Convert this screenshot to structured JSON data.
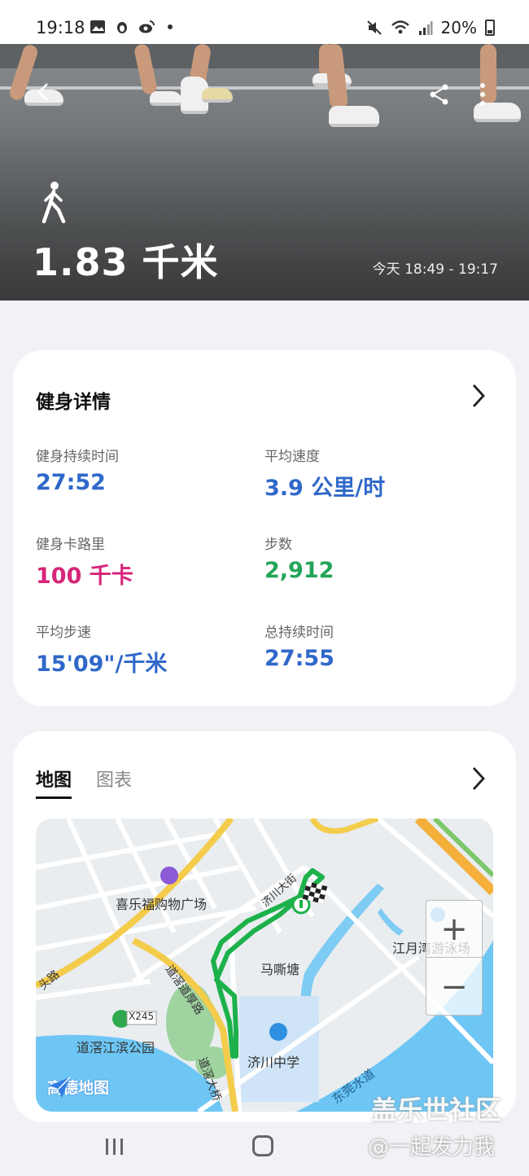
{
  "status_bar": {
    "time": "19:18",
    "battery": "20%"
  },
  "hero": {
    "distance": "1.83 千米",
    "time_range": "今天 18:49 - 19:17"
  },
  "details": {
    "title": "健身详情",
    "stats": [
      {
        "label": "健身持续时间",
        "value": "27:52",
        "color": "#2f68c9"
      },
      {
        "label": "平均速度",
        "value": "3.9 公里/时",
        "color": "#2f68c9"
      },
      {
        "label": "健身卡路里",
        "value": "100 千卡",
        "color": "#d6257a"
      },
      {
        "label": "步数",
        "value": "2,912",
        "color": "#23a559"
      },
      {
        "label": "平均步速",
        "value": "15'09\"/千米",
        "color": "#2f68c9"
      },
      {
        "label": "总持续时间",
        "value": "27:55",
        "color": "#2f68c9"
      }
    ]
  },
  "map_card": {
    "tabs": [
      "地图",
      "图表"
    ],
    "active_tab": "地图",
    "map_labels": {
      "mall": "喜乐福购物广场",
      "road_x245": "X245",
      "pond": "马嘶塘",
      "swim": "江月湾游泳场",
      "park": "道滘江滨公园",
      "school": "济川中学",
      "road_dongguan": "东莞水道",
      "bridge": "道滘大桥",
      "road_houde": "道滘道厚路",
      "road_frag": "头路",
      "road_jichuan": "济川大街"
    },
    "map_logo": "高德地图",
    "zoom_in": "+",
    "zoom_out": "−"
  },
  "watermark": {
    "line1": "盖乐世社区",
    "line2": "@一起发力我"
  }
}
